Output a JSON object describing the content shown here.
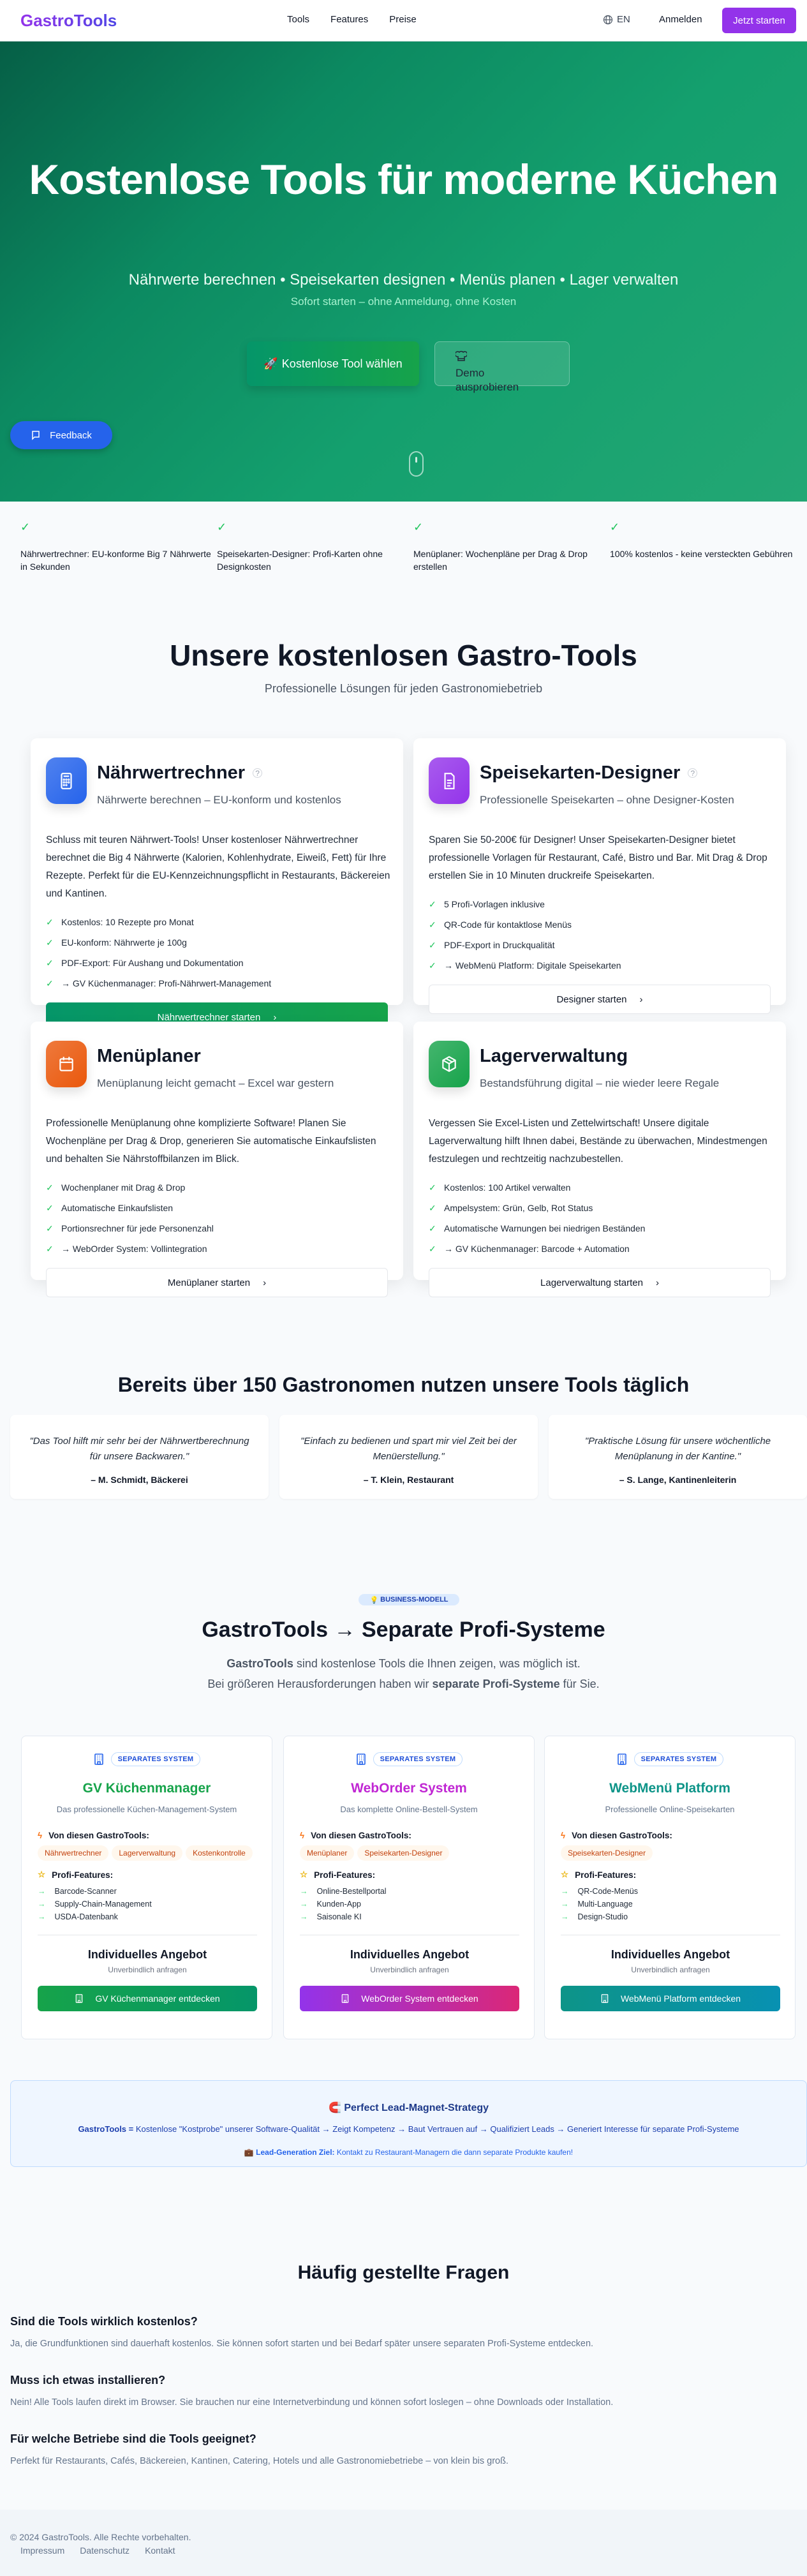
{
  "nav": {
    "logo": "GastroTools",
    "links": [
      "Tools",
      "Features",
      "Preise"
    ],
    "lang": "EN",
    "login": "Anmelden",
    "cta": "Jetzt starten"
  },
  "hero": {
    "title": "Kostenlose Tools für moderne Küchen",
    "subtitle": "Nährwerte berechnen • Speisekarten designen • Menüs planen • Lager verwalten",
    "note": "Sofort starten – ohne Anmeldung, ohne Kosten",
    "primary": "Kostenlose Tool wählen",
    "primary_icon": "🚀",
    "secondary": "Demo ausprobieren",
    "feedback": "Feedback"
  },
  "strip": [
    "Nährwertrechner: EU-konforme Big 7 Nährwerte in Sekunden",
    "Speisekarten-Designer: Profi-Karten ohne Designkosten",
    "Menüplaner: Wochenpläne per Drag & Drop erstellen",
    "100% kostenlos - keine versteckten Gebühren"
  ],
  "tools": {
    "title": "Unsere kostenlosen Gastro-Tools",
    "subtitle": "Professionelle Lösungen für jeden Gastronomiebetrieb",
    "cards": [
      {
        "title": "Nährwertrechner",
        "help": "?",
        "subtitle": "Nährwerte berechnen – EU-konform und kostenlos",
        "desc": "Schluss mit teuren Nährwert-Tools! Unser kostenloser Nährwertrechner berechnet die Big 4 Nährwerte (Kalorien, Kohlenhydrate, Eiweiß, Fett) für Ihre Rezepte. Perfekt für die EU-Kennzeichnungspflicht in Restaurants, Bäckereien und Kantinen.",
        "features": [
          "Kostenlos: 10 Rezepte pro Monat",
          "EU-konform: Nährwerte je 100g",
          "PDF-Export: Für Aushang und Dokumentation",
          "→ GV Küchenmanager: Profi-Nährwert-Management"
        ],
        "button": "Nährwertrechner starten",
        "color": "#2563eb",
        "icon": "calculator-icon"
      },
      {
        "title": "Speisekarten-Designer",
        "help": "?",
        "subtitle": "Professionelle Speisekarten – ohne Designer-Kosten",
        "desc": "Sparen Sie 50-200€ für Designer! Unser Speisekarten-Designer bietet professionelle Vorlagen für Restaurant, Café, Bistro und Bar. Mit Drag & Drop erstellen Sie in 10 Minuten druckreife Speisekarten.",
        "features": [
          "5 Profi-Vorlagen inklusive",
          "QR-Code für kontaktlose Menüs",
          "PDF-Export in Druckqualität",
          "→ WebMenü Platform: Digitale Speisekarten"
        ],
        "button": "Designer starten",
        "color": "#9333ea",
        "icon": "document-icon"
      },
      {
        "title": "Menüplaner",
        "subtitle": "Menüplanung leicht gemacht – Excel war gestern",
        "desc": "Professionelle Menüplanung ohne komplizierte Software! Planen Sie Wochenpläne per Drag & Drop, generieren Sie automatische Einkaufslisten und behalten Sie Nährstoffbilanzen im Blick.",
        "features": [
          "Wochenplaner mit Drag & Drop",
          "Automatische Einkaufslisten",
          "Portionsrechner für jede Personenzahl",
          "→ WebOrder System: Vollintegration"
        ],
        "button": "Menüplaner starten",
        "color": "#ea580c",
        "icon": "calendar-icon"
      },
      {
        "title": "Lagerverwaltung",
        "subtitle": "Bestandsführung digital – nie wieder leere Regale",
        "desc": "Vergessen Sie Excel-Listen und Zettelwirtschaft! Unsere digitale Lagerverwaltung hilft Ihnen dabei, Bestände zu überwachen, Mindestmengen festzulegen und rechtzeitig nachzubestellen.",
        "features": [
          "Kostenlos: 100 Artikel verwalten",
          "Ampelsystem: Grün, Gelb, Rot Status",
          "Automatische Warnungen bei niedrigen Beständen",
          "→ GV Küchenmanager: Barcode + Automation"
        ],
        "button": "Lagerverwaltung starten",
        "color": "#16a34a",
        "icon": "package-icon"
      }
    ]
  },
  "testimonials": {
    "title": "Bereits über 150 Gastronomen nutzen unsere Tools täglich",
    "items": [
      {
        "quote": "\"Das Tool hilft mir sehr bei der Nährwertberechnung für unsere Backwaren.\"",
        "author": "– M. Schmidt, Bäckerei"
      },
      {
        "quote": "\"Einfach zu bedienen und spart mir viel Zeit bei der Menüerstellung.\"",
        "author": "– T. Klein, Restaurant"
      },
      {
        "quote": "\"Praktische Lösung für unsere wöchentliche Menüplanung in der Kantine.\"",
        "author": "– S. Lange, Kantinenleiterin"
      }
    ]
  },
  "business": {
    "badge": "BUSINESS-MODELL",
    "badge_icon": "💡",
    "title": "GastroTools → Separate Profi-Systeme",
    "line1_bold": "GastroTools",
    "line1": " sind kostenlose Tools die Ihnen zeigen, was möglich ist.",
    "line2_a": "Bei größeren Herausforderungen haben wir ",
    "line2_bold": "separate Profi-Systeme",
    "line2_b": " für Sie.",
    "systems": [
      {
        "pill": "SEPARATES SYSTEM",
        "name": "GV Küchenmanager",
        "desc": "Das professionelle Küchen-Management-System",
        "from_label": "Von diesen GastroTools:",
        "tags": [
          "Nährwertrechner",
          "Lagerverwaltung",
          "Kostenkontrolle"
        ],
        "features_label": "Profi-Features:",
        "features": [
          "Barcode-Scanner",
          "Supply-Chain-Management",
          "USDA-Datenbank"
        ],
        "offer": "Individuelles Angebot",
        "offer_sub": "Unverbindlich anfragen",
        "button": "GV Küchenmanager entdecken",
        "color": "#16a34a"
      },
      {
        "pill": "SEPARATES SYSTEM",
        "name": "WebOrder System",
        "desc": "Das komplette Online-Bestell-System",
        "from_label": "Von diesen GastroTools:",
        "tags": [
          "Menüplaner",
          "Speisekarten-Designer"
        ],
        "features_label": "Profi-Features:",
        "features": [
          "Online-Bestellportal",
          "Kunden-App",
          "Saisonale KI"
        ],
        "offer": "Individuelles Angebot",
        "offer_sub": "Unverbindlich anfragen",
        "button": "WebOrder System entdecken",
        "color": "#c026d3"
      },
      {
        "pill": "SEPARATES SYSTEM",
        "name": "WebMenü Platform",
        "desc": "Professionelle Online-Speisekarten",
        "from_label": "Von diesen GastroTools:",
        "tags": [
          "Speisekarten-Designer"
        ],
        "features_label": "Profi-Features:",
        "features": [
          "QR-Code-Menüs",
          "Multi-Language",
          "Design-Studio"
        ],
        "offer": "Individuelles Angebot",
        "offer_sub": "Unverbindlich anfragen",
        "button": "WebMenü Platform entdecken",
        "color": "#0d9488"
      }
    ]
  },
  "lead": {
    "icon": "🧲",
    "title": "Perfect Lead-Magnet-Strategy",
    "flow_bold": "GastroTools =",
    "flow": " Kostenlose \"Kostprobe\" unserer Software-Qualität → Zeigt Kompetenz → Baut Vertrauen auf → Qualifiziert Leads → Generiert Interesse für separate Profi-Systeme",
    "goal_icon": "💼",
    "goal_bold": "Lead-Generation Ziel:",
    "goal": " Kontakt zu Restaurant-Managern die dann separate Produkte kaufen!"
  },
  "faq": {
    "title": "Häufig gestellte Fragen",
    "items": [
      {
        "q": "Sind die Tools wirklich kostenlos?",
        "a": "Ja, die Grundfunktionen sind dauerhaft kostenlos. Sie können sofort starten und bei Bedarf später unsere separaten Profi-Systeme entdecken."
      },
      {
        "q": "Muss ich etwas installieren?",
        "a": "Nein! Alle Tools laufen direkt im Browser. Sie brauchen nur eine Internetverbindung und können sofort loslegen – ohne Downloads oder Installation."
      },
      {
        "q": "Für welche Betriebe sind die Tools geeignet?",
        "a": "Perfekt für Restaurants, Cafés, Bäckereien, Kantinen, Catering, Hotels und alle Gastronomiebetriebe – von klein bis groß."
      }
    ]
  },
  "footer": {
    "copyright": "© 2024 GastroTools. Alle Rechte vorbehalten.",
    "links": [
      "Impressum",
      "Datenschutz",
      "Kontakt"
    ]
  }
}
